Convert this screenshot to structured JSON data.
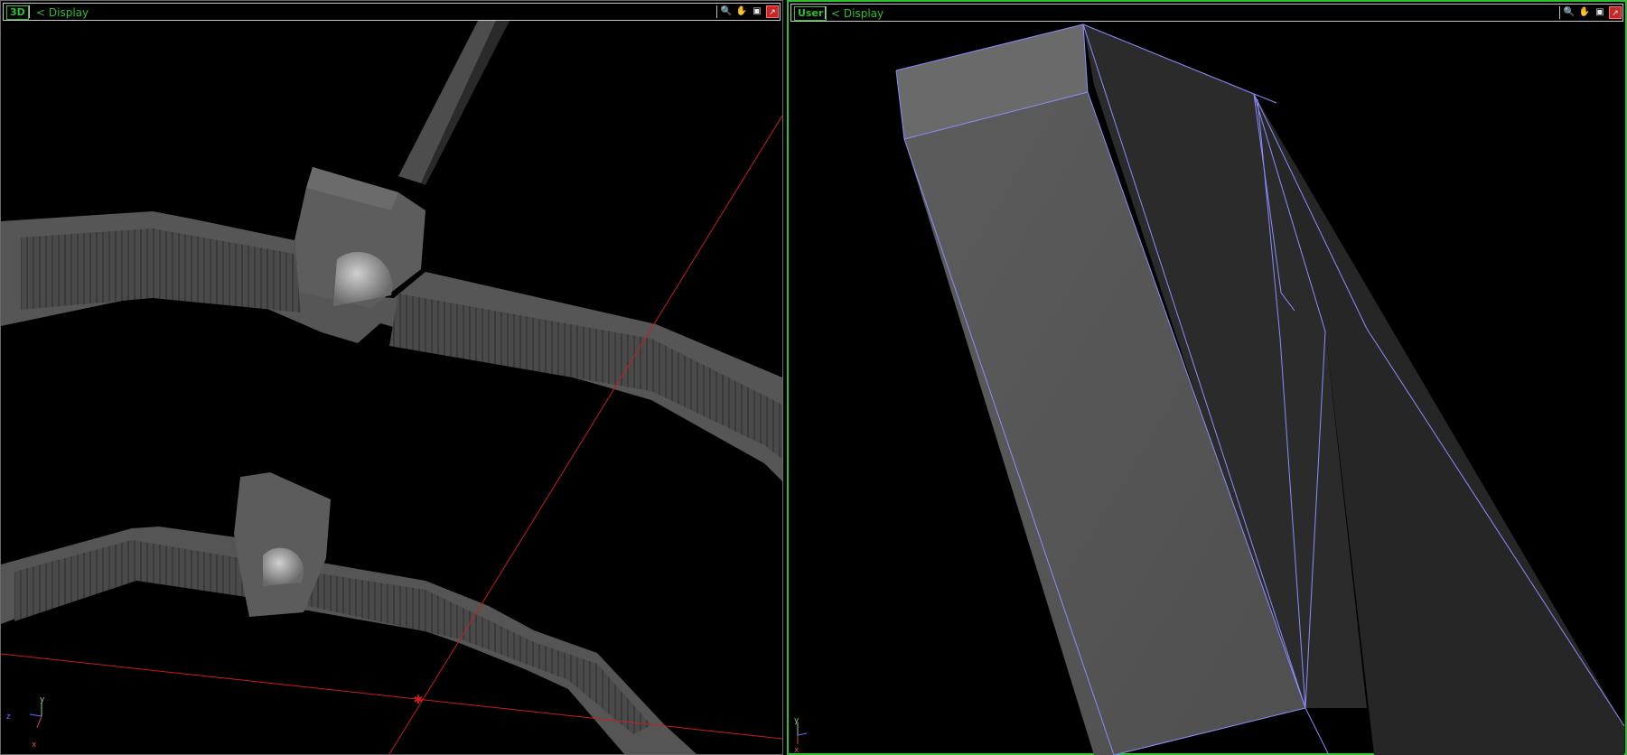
{
  "left_viewport": {
    "label": "3D",
    "menu": "< Display",
    "tools": [
      "zoom-icon",
      "pan-icon",
      "maximize-icon",
      "close-icon"
    ],
    "axes": {
      "x": "x",
      "y": "y",
      "z": "z"
    }
  },
  "right_viewport": {
    "label": "User",
    "menu": "< Display",
    "tools": [
      "zoom-icon",
      "pan-icon",
      "maximize-icon",
      "close-icon"
    ],
    "axes": {
      "x": "x",
      "y": "y"
    }
  },
  "colors": {
    "active_border": "#2fbf2f",
    "label_text": "#2fbf2f",
    "guide_line": "#c81e1e",
    "wireframe": "#8c8cff",
    "geometry": "#5c5c5c"
  }
}
